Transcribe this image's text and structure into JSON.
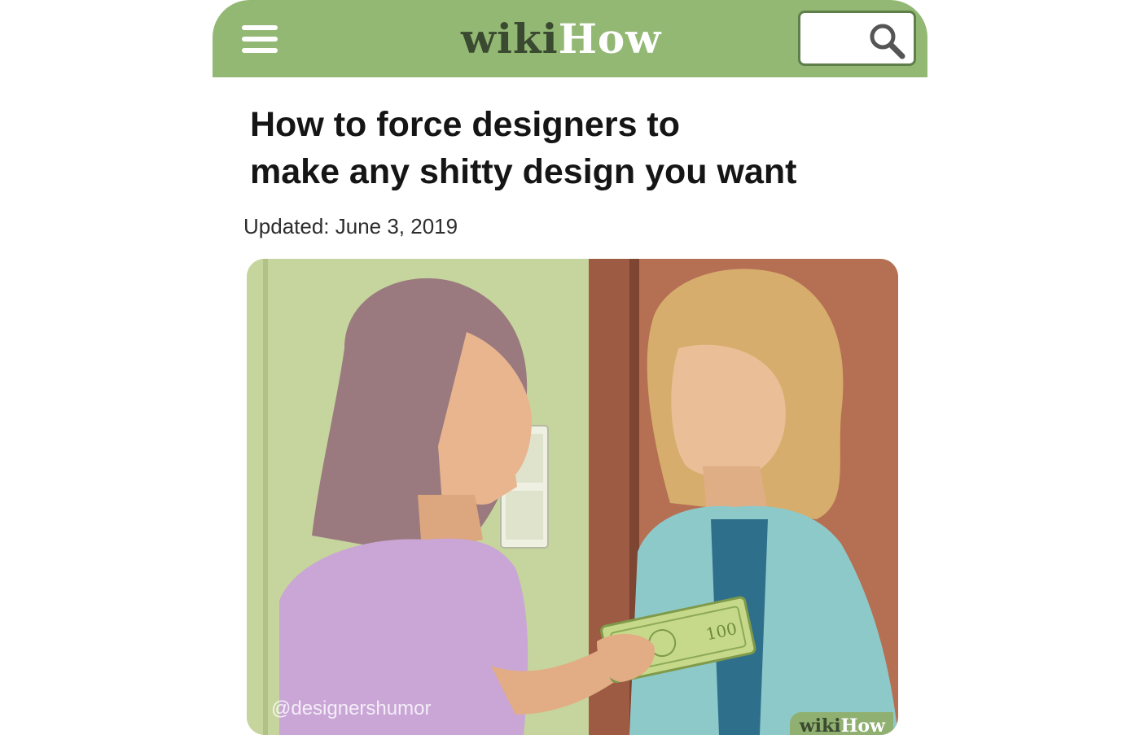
{
  "header": {
    "logo_wiki": "wiki",
    "logo_how": "How",
    "bar_color": "#93b874",
    "menu_icon": "hamburger-menu-icon",
    "search_icon": "magnifier-search-icon"
  },
  "article": {
    "title": "How to force designers to\nmake any shitty design you want",
    "updated": "Updated: June 3, 2019"
  },
  "illustration": {
    "watermark": "@designershumor",
    "logo_wiki": "wiki",
    "logo_how": "How",
    "banknote_value": "100"
  }
}
